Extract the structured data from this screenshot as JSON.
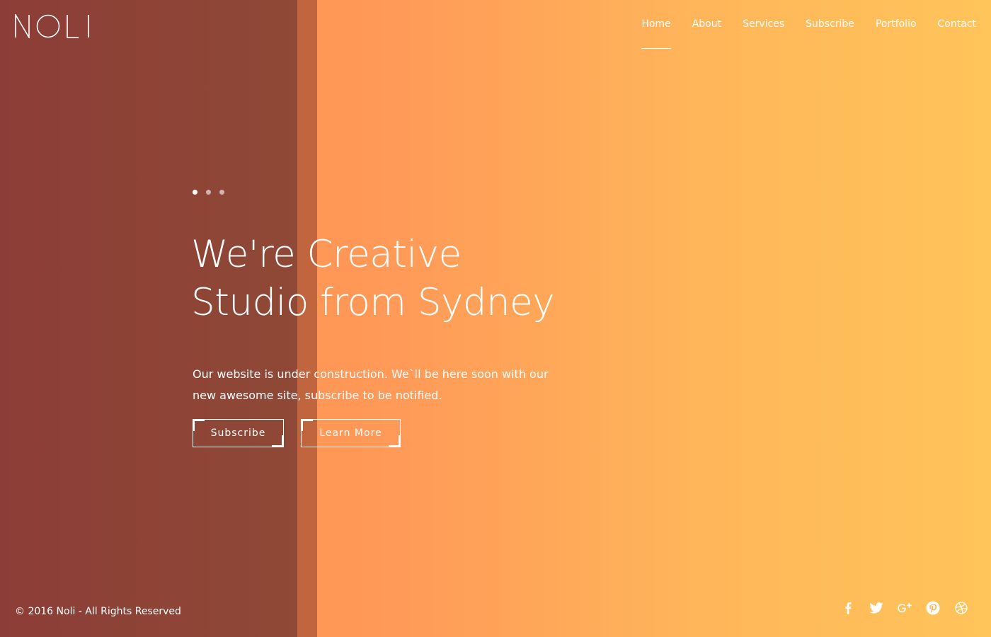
{
  "brand": {
    "logo_text": "NOLI"
  },
  "nav": {
    "items": [
      {
        "label": "Home",
        "active": true
      },
      {
        "label": "About"
      },
      {
        "label": "Services"
      },
      {
        "label": "Subscribe"
      },
      {
        "label": "Portfolio"
      },
      {
        "label": "Contact"
      }
    ]
  },
  "hero": {
    "slider": {
      "count": 3,
      "active_index": 0
    },
    "headline_line1": "We're Creative",
    "headline_line2": "Studio from Sydney",
    "tagline": "Our website is under construction. We`ll be here soon with our new awesome site, subscribe to be notified.",
    "buttons": {
      "subscribe_label": "Subscribe",
      "learn_more_label": "Learn More"
    }
  },
  "footer": {
    "copyright": "© 2016 Noli - All Rights Reserved",
    "social_icons": [
      "facebook-icon",
      "twitter-icon",
      "google-plus-icon",
      "pinterest-icon",
      "dribbble-icon"
    ]
  },
  "colors": {
    "dark_panel": "#8c3d37",
    "strip": "#c0653e",
    "gradient_start": "#ff8a50",
    "gradient_end": "#ffc45a",
    "text": "#ffffff"
  }
}
